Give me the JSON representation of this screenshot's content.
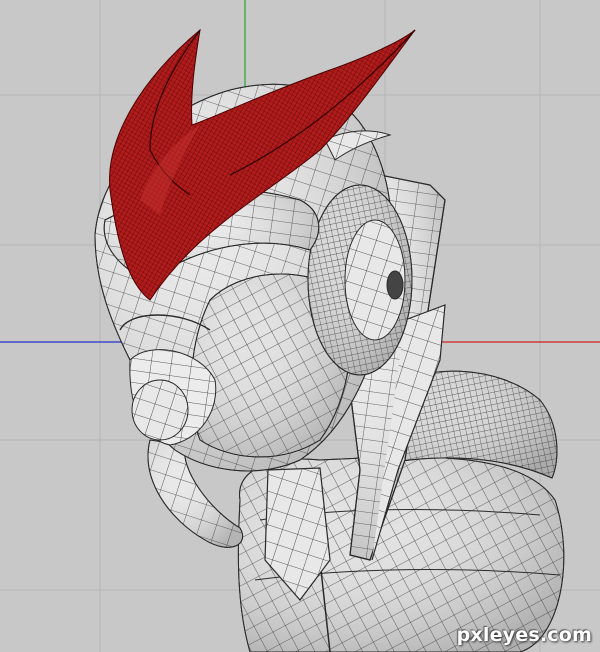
{
  "watermark": {
    "text": "pxleyes.com"
  },
  "colors": {
    "background": "#c8c8c8",
    "grid": "#b4b4b4",
    "axis_x": "#cc2222",
    "axis_y": "#22aa22",
    "axis_z": "#2233cc",
    "mesh_fill": "#e6e6e6",
    "mesh_line": "#2a2a2a",
    "helmet_fill": "#a01818",
    "helmet_line": "#4a0000"
  }
}
